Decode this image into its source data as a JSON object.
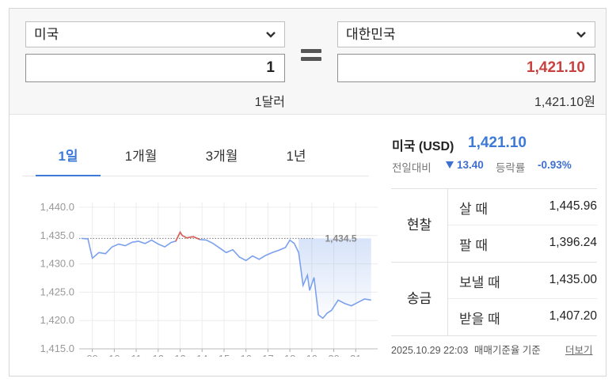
{
  "converter": {
    "from_currency": "미국",
    "from_amount": "1",
    "from_caption": "1달러",
    "to_currency": "대한민국",
    "to_amount": "1,421.10",
    "to_caption": "1,421.10원"
  },
  "tabs": [
    {
      "label": "1일",
      "active": true
    },
    {
      "label": "1개월",
      "active": false
    },
    {
      "label": "3개월",
      "active": false
    },
    {
      "label": "1년",
      "active": false
    }
  ],
  "info": {
    "title": "미국 (USD)",
    "rate": "1,421.10",
    "prev_label": "전일대비",
    "change": "13.40",
    "pct_label": "등락률",
    "pct": "-0.93%"
  },
  "rate_table": {
    "cash": {
      "header": "현찰",
      "buy_label": "살 때",
      "buy_value": "1,445.96",
      "sell_label": "팔 때",
      "sell_value": "1,396.24"
    },
    "transfer": {
      "header": "송금",
      "send_label": "보낼 때",
      "send_value": "1,435.00",
      "receive_label": "받을 때",
      "receive_value": "1,407.20"
    }
  },
  "footer": {
    "timestamp": "2025.10.29 22:03",
    "basis": "매매기준율 기준",
    "more": "더보기"
  },
  "colors": {
    "accent": "#3d7ad8",
    "up": "#e06052",
    "amount_red": "#c8413e"
  },
  "chart_data": {
    "type": "line",
    "x_labels": [
      "09",
      "10",
      "11",
      "12",
      "13",
      "14",
      "15",
      "16",
      "17",
      "18",
      "19",
      "20",
      "21"
    ],
    "y_ticks": [
      "1,440.0",
      "1,435.0",
      "1,430.0",
      "1,425.0",
      "1,420.0",
      "1,415.0"
    ],
    "ylim": [
      1415,
      1440
    ],
    "reference": {
      "value": 1434.5,
      "label": "1,434.5"
    },
    "x": [
      8.5,
      8.8,
      9.0,
      9.3,
      9.6,
      9.9,
      10.2,
      10.5,
      10.8,
      11.1,
      11.4,
      11.7,
      12.0,
      12.3,
      12.6,
      12.8,
      13.0,
      13.1,
      13.3,
      13.6,
      13.9,
      14.2,
      14.5,
      14.8,
      15.1,
      15.4,
      15.7,
      16.0,
      16.3,
      16.6,
      16.9,
      17.2,
      17.5,
      17.8,
      18.0,
      18.2,
      18.4,
      18.6,
      18.8,
      18.9,
      19.1,
      19.3,
      19.5,
      19.7,
      19.9,
      20.2,
      20.5,
      20.8,
      21.1,
      21.4,
      21.7
    ],
    "y": [
      1434.5,
      1434.4,
      1431.0,
      1432.0,
      1431.8,
      1433.0,
      1433.5,
      1433.2,
      1433.8,
      1434.0,
      1433.6,
      1434.2,
      1433.5,
      1433.0,
      1433.8,
      1434.0,
      1435.6,
      1435.0,
      1434.6,
      1434.8,
      1434.3,
      1434.2,
      1433.6,
      1432.8,
      1432.0,
      1432.5,
      1431.2,
      1430.6,
      1431.4,
      1430.8,
      1431.5,
      1432.0,
      1432.4,
      1432.9,
      1434.2,
      1433.6,
      1432.0,
      1426.2,
      1428.0,
      1425.3,
      1427.6,
      1421.0,
      1420.4,
      1421.3,
      1421.8,
      1423.6,
      1423.0,
      1422.6,
      1423.2,
      1423.8,
      1423.6
    ],
    "up_range": [
      12.8,
      13.9
    ]
  }
}
